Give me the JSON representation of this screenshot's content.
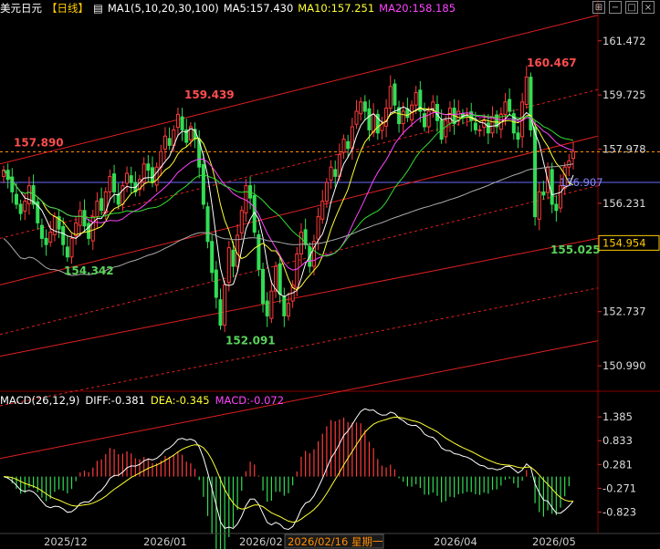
{
  "header": {
    "symbol": "美元日元",
    "period": "【日线】",
    "ma_label": "MA1(5,10,20,30,100)",
    "ma5": "MA5:157.430",
    "ma10": "MA10:157.251",
    "ma20": "MA20:158.185",
    "colors": {
      "symbol": "#ffffff",
      "period": "#ffcc00",
      "ma": "#ffffff",
      "ma5": "#ffffff",
      "ma10": "#ffff33",
      "ma20": "#ff44ff"
    }
  },
  "window_icons": [
    "grid-icon",
    "minimize-icon",
    "restore-icon",
    "close-icon"
  ],
  "macd_header": {
    "label": "MACD(26,12,9)",
    "diff": "DIFF:-0.381",
    "dea": "DEA:-0.345",
    "macd": "MACD:-0.072"
  },
  "chart_data": [
    {
      "type": "candlestick",
      "title": "美元日元 日线",
      "y_ticks": [
        "161.472",
        "159.725",
        "157.978",
        "156.231",
        "152.737",
        "150.990"
      ],
      "ylim": [
        150.2,
        162.2
      ],
      "x_ticks": [
        "2025/12",
        "2026/01",
        "2026/02",
        "2026/04",
        "2026/05"
      ],
      "cursor_date": "2026/02/16 星期一",
      "price_tags": {
        "last": "154.954",
        "horizontal_line": "156.907"
      },
      "annotations": [
        {
          "text": "157.890",
          "value": 157.89,
          "kind": "high",
          "color": "#ff4d4d"
        },
        {
          "text": "154.342",
          "value": 154.342,
          "kind": "low",
          "color": "#5bd35b"
        },
        {
          "text": "159.439",
          "value": 159.439,
          "kind": "high",
          "color": "#ff4d4d"
        },
        {
          "text": "152.091",
          "value": 152.091,
          "kind": "low",
          "color": "#5bd35b"
        },
        {
          "text": "160.467",
          "value": 160.467,
          "kind": "high",
          "color": "#ff4d4d"
        },
        {
          "text": "155.025",
          "value": 155.025,
          "kind": "low",
          "color": "#5bd35b"
        }
      ],
      "reference_levels": [
        {
          "value": 157.89,
          "style": "dashed",
          "color": "#ff8c00"
        },
        {
          "value": 156.907,
          "style": "solid",
          "color": "#6a6aff"
        }
      ],
      "closes": [
        157.3,
        157.0,
        156.6,
        156.2,
        155.9,
        156.3,
        156.8,
        156.2,
        155.6,
        155.1,
        154.9,
        155.3,
        155.8,
        155.4,
        154.9,
        154.5,
        155.1,
        155.6,
        156.0,
        155.5,
        155.1,
        155.8,
        156.3,
        156.0,
        156.6,
        157.1,
        156.6,
        156.2,
        156.8,
        157.2,
        156.9,
        156.6,
        157.0,
        157.5,
        157.3,
        156.9,
        157.4,
        157.9,
        158.4,
        158.1,
        158.6,
        159.1,
        158.6,
        158.2,
        158.7,
        158.3,
        157.4,
        156.2,
        155.0,
        154.0,
        153.2,
        152.3,
        153.6,
        154.8,
        154.2,
        155.2,
        156.0,
        156.8,
        156.4,
        155.3,
        154.1,
        153.0,
        152.6,
        153.4,
        154.2,
        153.3,
        152.6,
        153.0,
        153.6,
        154.6,
        155.3,
        154.9,
        154.2,
        155.0,
        155.8,
        156.3,
        156.9,
        157.4,
        157.1,
        157.8,
        158.3,
        158.0,
        158.7,
        159.2,
        159.5,
        159.2,
        158.6,
        159.1,
        158.5,
        158.8,
        159.3,
        160.0,
        159.4,
        158.8,
        159.2,
        159.0,
        159.4,
        159.8,
        159.2,
        158.7,
        159.2,
        159.5,
        158.9,
        158.3,
        158.9,
        159.3,
        158.8,
        159.2,
        159.0,
        159.1,
        158.9,
        158.6,
        158.6,
        158.9,
        158.5,
        159.0,
        158.7,
        159.1,
        159.5,
        159.2,
        158.5,
        158.3,
        159.5,
        160.3,
        158.6,
        155.8,
        156.6,
        156.5,
        157.4,
        156.2,
        156.0,
        156.8,
        157.4,
        157.6,
        157.9
      ],
      "ma_series": [
        {
          "name": "MA5",
          "color": "#ffffff"
        },
        {
          "name": "MA10",
          "color": "#ffff33"
        },
        {
          "name": "MA20",
          "color": "#ff44ff"
        },
        {
          "name": "MA30",
          "color": "#33dd33"
        },
        {
          "name": "MA100",
          "color": "#aaaaaa"
        }
      ]
    },
    {
      "type": "macd",
      "title": "MACD(26,12,9)",
      "y_ticks": [
        "1.385",
        "0.833",
        "0.281",
        "-0.271",
        "-0.823"
      ],
      "ylim": [
        -1.3,
        1.6
      ],
      "series": [
        {
          "name": "DIFF",
          "color": "#ffffff"
        },
        {
          "name": "DEA",
          "color": "#ffff33"
        },
        {
          "name": "MACD",
          "color": "#ff44ff"
        }
      ],
      "values": {
        "DIFF": -0.381,
        "DEA": -0.345,
        "MACD": -0.072
      }
    }
  ]
}
